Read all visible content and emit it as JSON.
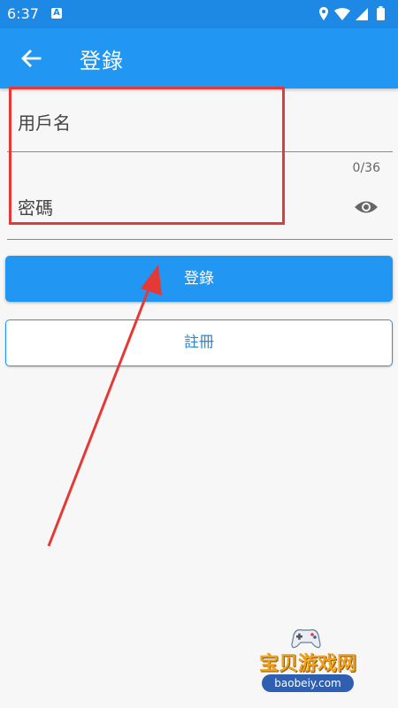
{
  "status_bar": {
    "time": "6:37",
    "app_icon_letter": "A"
  },
  "app_bar": {
    "title": "登錄"
  },
  "form": {
    "username_label": "用戶名",
    "password_label": "密碼",
    "password_counter": "0/36"
  },
  "buttons": {
    "login_label": "登錄",
    "register_label": "註冊"
  },
  "watermark": {
    "name": "宝贝游戏网",
    "url": "baobeiy.com"
  },
  "colors": {
    "primary": "#2196f3",
    "status": "#1e88e5",
    "annotation": "#e53935"
  }
}
